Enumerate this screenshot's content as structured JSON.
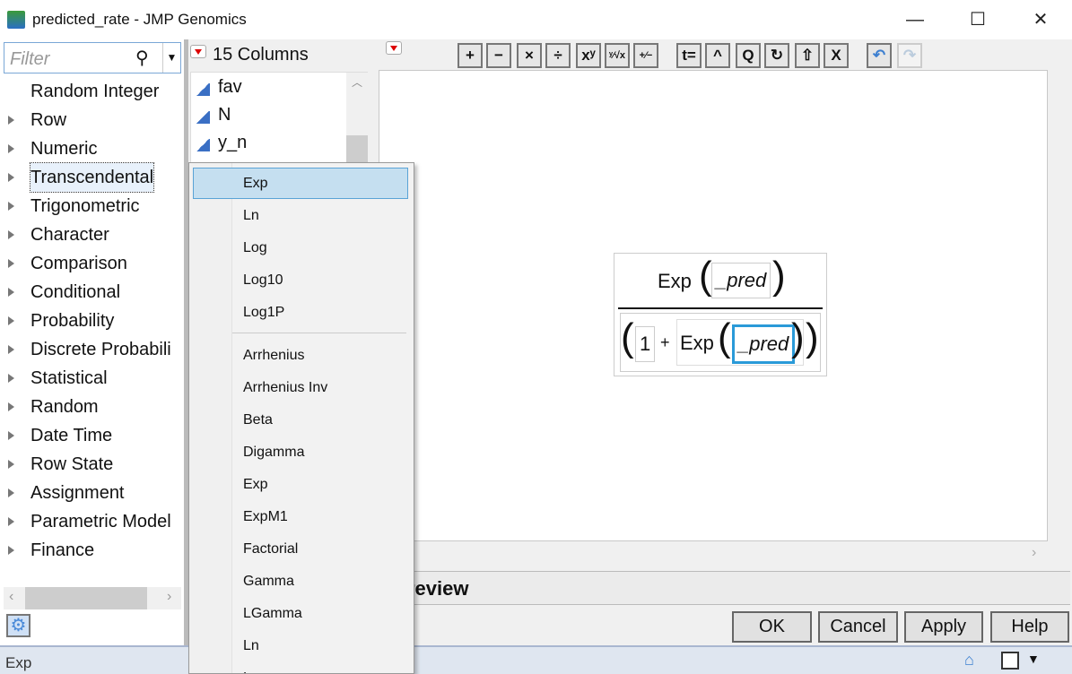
{
  "window": {
    "title": "predicted_rate - JMP Genomics",
    "minimize": "—",
    "maximize": "☐",
    "close": "✕"
  },
  "filter": {
    "placeholder": "Filter"
  },
  "categories": [
    "Random Integer",
    "Row",
    "Numeric",
    "Transcendental",
    "Trigonometric",
    "Character",
    "Comparison",
    "Conditional",
    "Probability",
    "Discrete Probabili",
    "Statistical",
    "Random",
    "Date Time",
    "Row State",
    "Assignment",
    "Parametric Model",
    "Finance"
  ],
  "columns": {
    "header": "15 Columns",
    "items": [
      "fav",
      "N",
      "y_n"
    ]
  },
  "toolbar": [
    "+",
    "−",
    "×",
    "÷",
    "xʸ",
    "ʸ⁄√x",
    "+⁄−",
    "t=",
    "^",
    "Q",
    "↻",
    "⇧",
    "X"
  ],
  "formula": {
    "numerator_fn": "Exp",
    "numerator_arg": "_pred",
    "one": "1",
    "plus": "+",
    "denominator_fn": "Exp",
    "denominator_arg": "_pred"
  },
  "preview": {
    "label": "review"
  },
  "buttons": {
    "ok": "OK",
    "cancel": "Cancel",
    "apply": "Apply",
    "help": "Help"
  },
  "status": {
    "text": "Exp"
  },
  "menu": {
    "group1": [
      "Exp",
      "Ln",
      "Log",
      "Log10",
      "Log1P"
    ],
    "group2": [
      "Arrhenius",
      "Arrhenius Inv",
      "Beta",
      "Digamma",
      "Exp",
      "ExpM1",
      "Factorial",
      "Gamma",
      "LGamma",
      "Ln",
      "L"
    ]
  }
}
